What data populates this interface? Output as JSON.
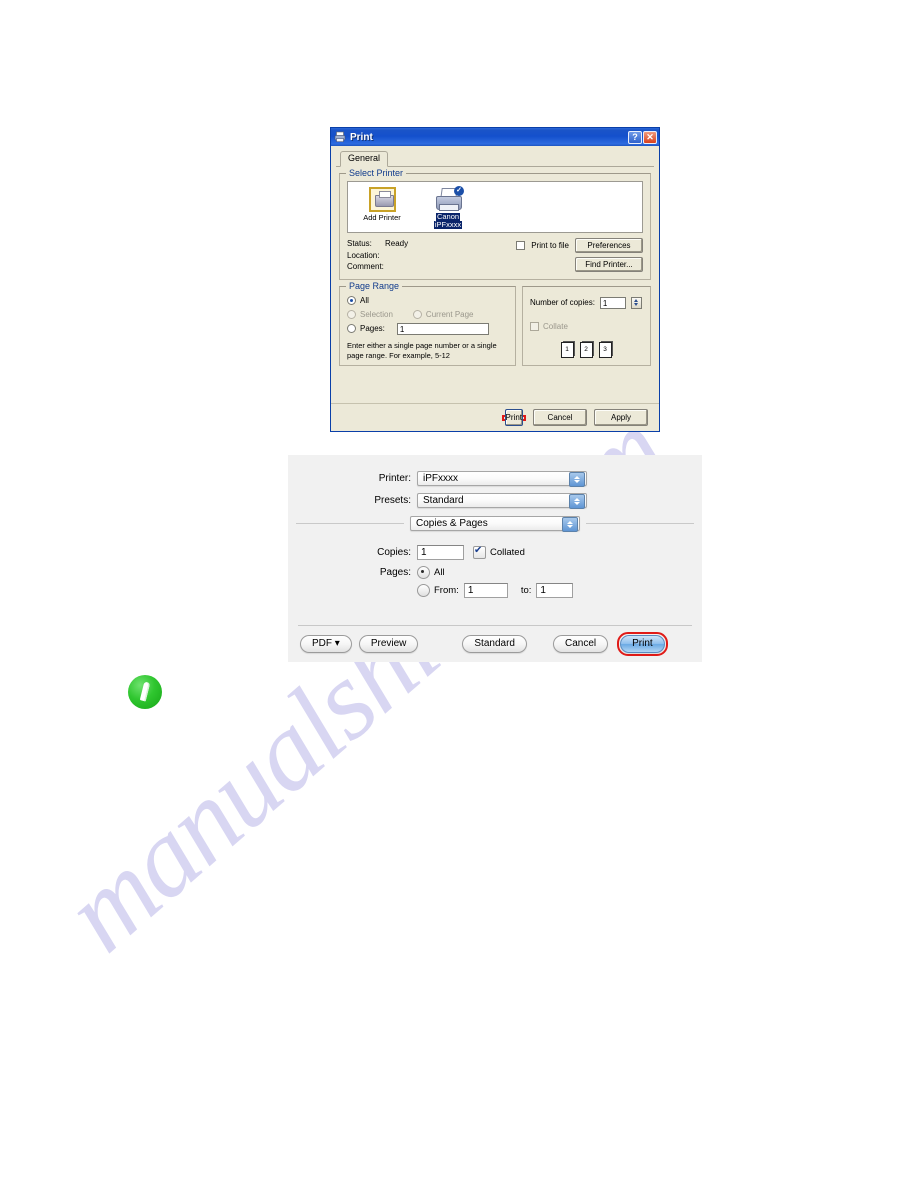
{
  "page": {
    "watermark_text": "manualshive.com"
  },
  "windows_dialog": {
    "title": "Print",
    "titlebar_icon": "printer-icon",
    "help_button": "?",
    "close_button": "✕",
    "tabs": [
      {
        "label": "General",
        "selected": true
      }
    ],
    "select_printer": {
      "legend": "Select Printer",
      "printers": [
        {
          "name": "Add Printer",
          "icon": "add-printer-icon",
          "selected": false
        },
        {
          "name_line1": "Canon",
          "name_line2": "iPFxxxx",
          "icon": "canon-printer-icon",
          "selected": true,
          "default_badge": "✓"
        }
      ],
      "status_label": "Status:",
      "status_value": "Ready",
      "location_label": "Location:",
      "location_value": "",
      "comment_label": "Comment:",
      "comment_value": "",
      "print_to_file_label": "Print to file",
      "print_to_file_checked": false,
      "preferences_button": "Preferences",
      "find_printer_button": "Find Printer..."
    },
    "page_range": {
      "legend": "Page Range",
      "options": [
        {
          "label": "All",
          "selected": true,
          "disabled": false
        },
        {
          "label": "Selection",
          "selected": false,
          "disabled": true
        },
        {
          "label": "Current Page",
          "selected": false,
          "disabled": true
        },
        {
          "label": "Pages:",
          "selected": false,
          "disabled": false
        }
      ],
      "pages_value": "1",
      "hint_line1": "Enter either a single page number or a single",
      "hint_line2": "page range. For example, 5-12"
    },
    "copies": {
      "number_of_copies_label": "Number of copies:",
      "number_of_copies_value": "1",
      "collate_label": "Collate",
      "collate_checked": false,
      "collate_disabled": true,
      "preview_pages": [
        {
          "front": "1",
          "back": "1"
        },
        {
          "front": "2",
          "back": "2"
        },
        {
          "front": "3",
          "back": "3"
        }
      ]
    },
    "footer_buttons": [
      {
        "label": "Print",
        "highlighted": true
      },
      {
        "label": "Cancel",
        "highlighted": false
      },
      {
        "label": "Apply",
        "highlighted": false
      }
    ]
  },
  "mac_dialog": {
    "printer_label": "Printer:",
    "printer_value": "iPFxxxx",
    "presets_label": "Presets:",
    "presets_value": "Standard",
    "pane_value": "Copies & Pages",
    "copies_label": "Copies:",
    "copies_value": "1",
    "collated_label": "Collated",
    "collated_checked": true,
    "pages_label": "Pages:",
    "pages_all_label": "All",
    "pages_all_selected": true,
    "pages_from_label": "From:",
    "pages_from_value": "1",
    "pages_to_label": "to:",
    "pages_to_value": "1",
    "footer_buttons": {
      "pdf": "PDF ▾",
      "preview": "Preview",
      "standard": "Standard",
      "cancel": "Cancel",
      "print": "Print"
    }
  },
  "note": {
    "icon": "note-pencil-icon"
  },
  "colors": {
    "xp_titlebar_blue": "#1450cc",
    "xp_face": "#ece9d8",
    "highlight_red": "#e01b18",
    "selection_blue": "#0a246a",
    "mac_face": "#f1f1f1",
    "mac_accent_blue": "#6aa9e4",
    "note_green": "#2fc62f",
    "watermark_purple": "#b9b6e8"
  }
}
